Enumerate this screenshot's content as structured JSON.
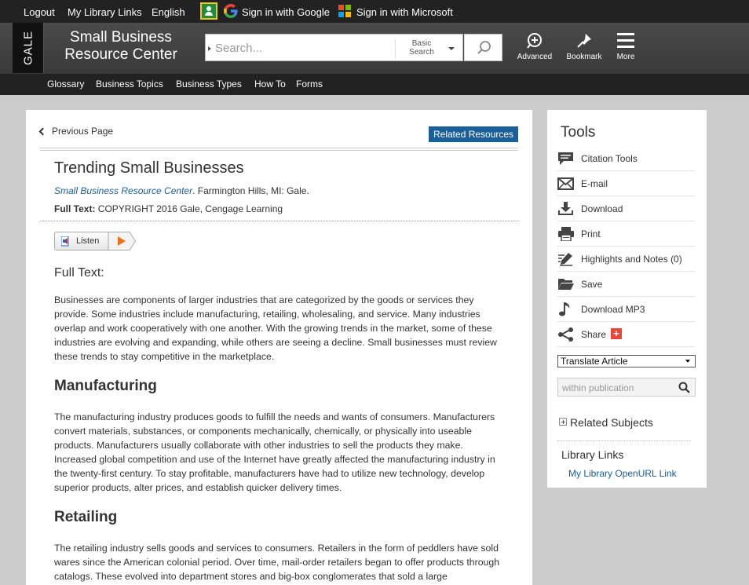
{
  "utility_bar": {
    "logout": "Logout",
    "library_links": "My Library Links",
    "language": "English",
    "sign_in_google": "Sign in with Google",
    "sign_in_microsoft": "Sign in with Microsoft"
  },
  "header": {
    "logo_text": "GALE",
    "site_title_line1": "Small Business",
    "site_title_line2": "Resource Center",
    "search_placeholder": "Search...",
    "search_type_line1": "Basic",
    "search_type_line2": "Search",
    "advanced_label": "Advanced",
    "bookmark_label": "Bookmark",
    "more_label": "More"
  },
  "nav": {
    "items": [
      "Glossary",
      "Business Topics",
      "Business Types",
      "How To",
      "Forms"
    ]
  },
  "article": {
    "previous_page": "Previous Page",
    "related_resources": "Related Resources",
    "title": "Trending Small Businesses",
    "source_publication": "Small Business Resource Center",
    "source_rest": ". Farmington Hills, MI: Gale.",
    "full_text_label": "Full Text:",
    "copyright": " COPYRIGHT 2016 Gale, Cengage Learning",
    "listen_label": "Listen",
    "full_text_heading": "Full Text:",
    "intro_paragraph": "Businesses are components of larger industries that are categorized by the goods or services they provide. Some industries include manufacturing, retailing, wholesaling, and service. Many industries overlap and work cooperatively with one another. With the growing trends in the market, some of these industries are evolving and expanding, while others are seeing a decline. Small businesses must review these trends to stay competitive in the marketplace.",
    "manufacturing_heading": "Manufacturing",
    "manufacturing_paragraph": "The manufacturing industry produces goods to fulfill the needs and wants of consumers. Manufacturers convert materials, substances, or components mechanically, chemically, or physically into useable products. Manufacturers usually collaborate with other industries to sell the products they make. Increased global competition and use of the Internet have greatly affected the manufacturing industry in the twenty-first century. To stay profitable, manufacturers have had to utilize new technology, develop superior products, alter prices, and establish quicker delivery times.",
    "retailing_heading": "Retailing",
    "retailing_paragraph": "The retailing industry sells goods and services to consumers. Retailers in the form of peddlers have sold wares since the American colonial period. Over time, mail-order retailers began to offer products through catalogs. These evolved into department stores and big-box conglomerates that sold a large"
  },
  "tools": {
    "title": "Tools",
    "items": [
      {
        "label": "Citation Tools",
        "icon": "speech-bubble-icon"
      },
      {
        "label": "E-mail",
        "icon": "envelope-icon"
      },
      {
        "label": "Download",
        "icon": "download-icon"
      },
      {
        "label": "Print",
        "icon": "printer-icon"
      },
      {
        "label": "Highlights and Notes (0)",
        "icon": "pencil-icon"
      },
      {
        "label": "Save",
        "icon": "folder-icon"
      },
      {
        "label": "Download MP3",
        "icon": "music-note-icon"
      },
      {
        "label": "Share",
        "icon": "share-icon"
      }
    ],
    "share_plus": "+",
    "translate_selected": "Translate Article",
    "within_placeholder": "within publication",
    "related_subjects": "Related Subjects",
    "library_links_title": "Library Links",
    "library_link": "My Library OpenURL Link"
  },
  "colors": {
    "link_blue": "#1a5e9a",
    "top_bar": "#222222",
    "header": "#3f3f3f",
    "page_bg": "#cccccc",
    "share_red": "#e8483c"
  }
}
